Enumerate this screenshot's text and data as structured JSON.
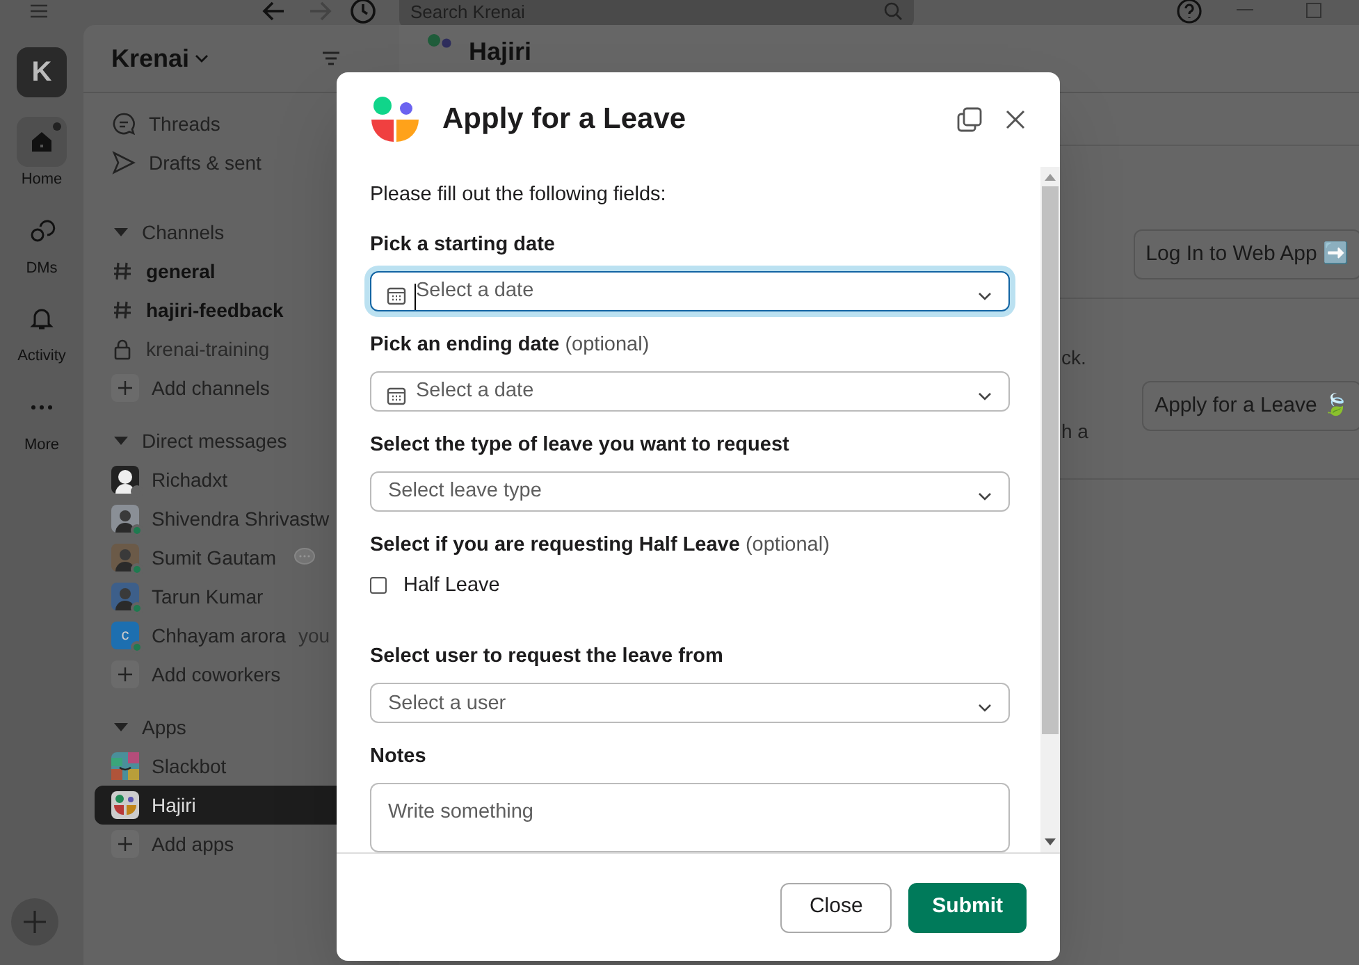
{
  "search": {
    "placeholder": "Search Krenai"
  },
  "rail": [
    {
      "label": "Home",
      "kind": "home",
      "selected": true,
      "badge": true
    },
    {
      "label": "DMs",
      "kind": "dms",
      "selected": false,
      "badge": false
    },
    {
      "label": "Activity",
      "kind": "activity",
      "selected": false,
      "badge": false
    },
    {
      "label": "More",
      "kind": "more",
      "selected": false,
      "badge": false
    }
  ],
  "workspace": {
    "initial": "K",
    "name": "Krenai"
  },
  "sidebar_top": [
    {
      "label": "Threads",
      "kind": "threads"
    },
    {
      "label": "Drafts & sent",
      "kind": "drafts"
    }
  ],
  "channels": {
    "title": "Channels",
    "items": [
      {
        "label": "general",
        "kind": "public",
        "unread": true
      },
      {
        "label": "hajiri-feedback",
        "kind": "public",
        "unread": true
      },
      {
        "label": "krenai-training",
        "kind": "private",
        "unread": false
      }
    ],
    "add": "Add channels"
  },
  "direct_messages": {
    "title": "Direct messages",
    "items": [
      {
        "label": "Richadxt",
        "online": false,
        "kind": "silhouette",
        "color": "#222222"
      },
      {
        "label": "Shivendra Shrivastw",
        "online": true,
        "kind": "photo",
        "color": "#8a8f96"
      },
      {
        "label": "Sumit Gautam",
        "online": true,
        "kind": "photo",
        "color": "#6b5a48",
        "bubble": true
      },
      {
        "label": "Tarun Kumar",
        "online": true,
        "kind": "photo",
        "color": "#3d5f8a"
      },
      {
        "label": "Chhayam arora",
        "online": true,
        "kind": "letter",
        "letter": "c",
        "color": "#1d6fb0",
        "suffix": "you"
      }
    ],
    "add": "Add coworkers"
  },
  "apps": {
    "title": "Apps",
    "items": [
      {
        "label": "Slackbot",
        "kind": "slackbot",
        "selected": false
      },
      {
        "label": "Hajiri",
        "kind": "hajiri",
        "selected": true
      }
    ],
    "add": "Add apps"
  },
  "channel_header": {
    "title": "Hajiri"
  },
  "main": {
    "buttons": [
      "Log In to Web App ➡️",
      "Apply for a Leave 🍃"
    ],
    "fragments": [
      "ck.",
      "h a"
    ]
  },
  "modal": {
    "title": "Apply for a Leave",
    "intro": "Please fill out the following fields:",
    "fields": [
      {
        "kind": "date",
        "label": "Pick a starting date",
        "placeholder": "Select a date",
        "focused": true
      },
      {
        "kind": "date",
        "label": "Pick an ending date",
        "optional": "(optional)",
        "placeholder": "Select a date",
        "focused": false
      },
      {
        "kind": "select",
        "label": "Select the type of leave you want to request",
        "placeholder": "Select leave type",
        "focused": false
      },
      {
        "kind": "checkbox",
        "label": "Select if you are requesting Half Leave",
        "optional": "(optional)",
        "option": "Half Leave",
        "checked": false
      },
      {
        "kind": "select",
        "label": "Select user to request the leave from",
        "placeholder": "Select a user",
        "focused": false
      },
      {
        "kind": "textarea",
        "label": "Notes",
        "placeholder": "Write something",
        "focused": false
      }
    ],
    "buttons": [
      {
        "label": "Close",
        "kind": "secondary"
      },
      {
        "label": "Submit",
        "kind": "primary"
      }
    ]
  }
}
